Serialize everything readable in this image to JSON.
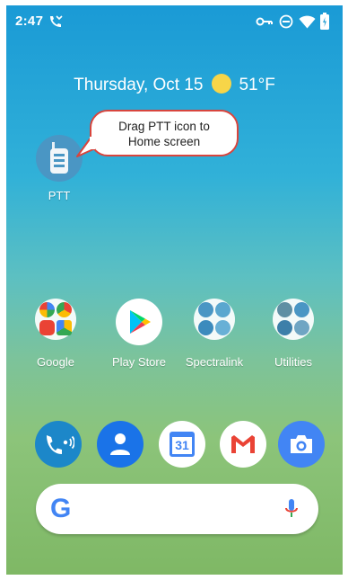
{
  "status_bar": {
    "time": "2:47",
    "icons": [
      "missed-call-icon",
      "vpn-key-icon",
      "do-not-disturb-icon",
      "wifi-icon",
      "battery-charging-icon"
    ]
  },
  "date_widget": {
    "date": "Thursday, Oct 15",
    "weather_icon": "sun-icon",
    "temperature": "51°F"
  },
  "callout": {
    "text_line1": "Drag PTT icon to",
    "text_line2": "Home screen"
  },
  "home_apps": [
    {
      "label": "PTT",
      "icon": "ptt-walkie-talkie-icon"
    },
    {
      "label": "Google",
      "icon": "google-folder-icon"
    },
    {
      "label": "Play Store",
      "icon": "play-store-icon"
    },
    {
      "label": "Spectralink",
      "icon": "spectralink-folder-icon"
    },
    {
      "label": "Utilities",
      "icon": "utilities-folder-icon"
    }
  ],
  "dock": [
    {
      "name": "phone",
      "icon": "phone-wifi-call-icon"
    },
    {
      "name": "contacts",
      "icon": "contacts-icon"
    },
    {
      "name": "calendar",
      "icon": "calendar-icon",
      "day": "31"
    },
    {
      "name": "gmail",
      "icon": "gmail-icon"
    },
    {
      "name": "camera",
      "icon": "camera-icon"
    }
  ],
  "search_bar": {
    "logo": "G",
    "mic_icon": "microphone-icon"
  },
  "colors": {
    "callout_border": "#d9453d",
    "ptt_icon_bg": "#4a96c4",
    "sun": "#f7d548"
  }
}
